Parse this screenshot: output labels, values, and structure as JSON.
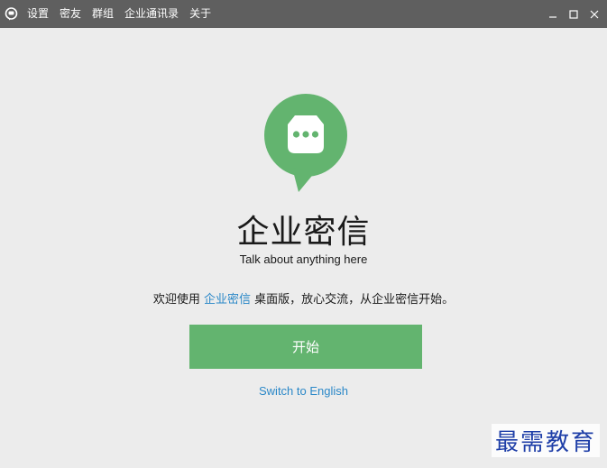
{
  "titlebar": {
    "menu": [
      {
        "label": "设置"
      },
      {
        "label": "密友"
      },
      {
        "label": "群组"
      },
      {
        "label": "企业通讯录"
      },
      {
        "label": "关于"
      }
    ]
  },
  "main": {
    "app_name": "企业密信",
    "tagline": "Talk about anything here",
    "welcome_prefix": "欢迎使用 ",
    "welcome_highlight": "企业密信",
    "welcome_suffix": " 桌面版，放心交流，从企业密信开始。",
    "start_label": "开始",
    "switch_language_label": "Switch to English"
  },
  "watermark": {
    "text": "最需教育"
  },
  "colors": {
    "titlebar": "#5f5f5f",
    "background": "#ececec",
    "brand_green": "#63b46f",
    "link_blue": "#2b88c8"
  },
  "icons": {
    "app": "chat-bubble-icon",
    "logo": "chat-bubble-dots-icon",
    "minimize": "minimize-icon",
    "maximize": "maximize-icon",
    "close": "close-icon"
  }
}
